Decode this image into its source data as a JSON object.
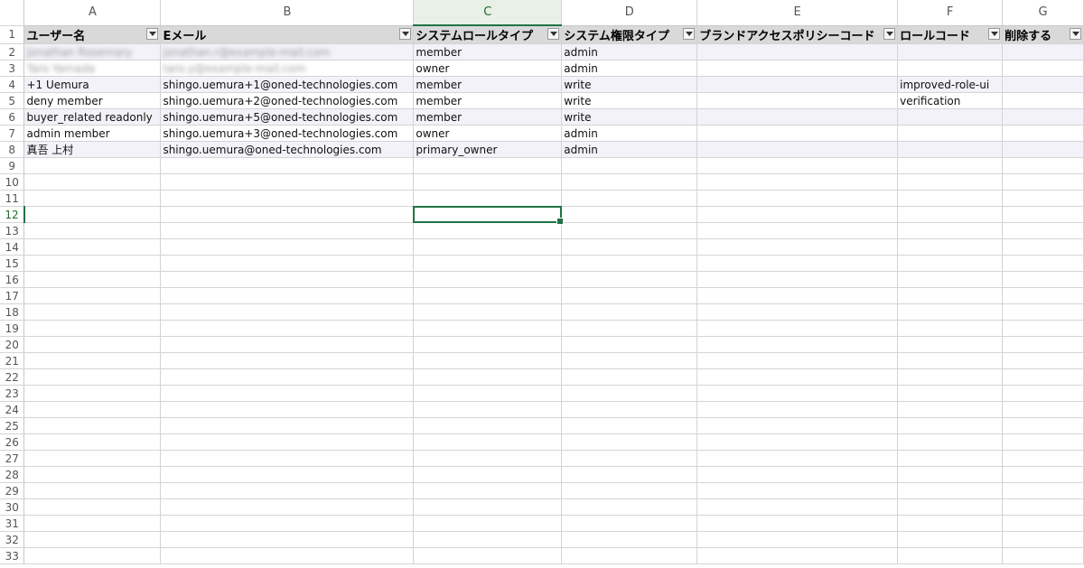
{
  "columns": [
    "A",
    "B",
    "C",
    "D",
    "E",
    "F",
    "G"
  ],
  "header_row_number": "1",
  "headers": [
    "ユーザー名",
    "Eメール",
    "システムロールタイプ",
    "システム権限タイプ",
    "ブランドアクセスポリシーコード",
    "ロールコード",
    "削除する"
  ],
  "rows": [
    {
      "num": "2",
      "cells": [
        "Jonathan Rosemary",
        "jonathan.r@example-mail.com",
        "member",
        "admin",
        "",
        "",
        ""
      ]
    },
    {
      "num": "3",
      "cells": [
        "Taro Yamada",
        "taro.y@example-mail.com",
        "owner",
        "admin",
        "",
        "",
        ""
      ]
    },
    {
      "num": "4",
      "cells": [
        "+1 Uemura",
        "shingo.uemura+1@oned-technologies.com",
        "member",
        "write",
        "",
        "improved-role-ui",
        ""
      ]
    },
    {
      "num": "5",
      "cells": [
        "deny member",
        "shingo.uemura+2@oned-technologies.com",
        "member",
        "write",
        "",
        "verification",
        ""
      ]
    },
    {
      "num": "6",
      "cells": [
        "buyer_related readonly",
        "shingo.uemura+5@oned-technologies.com",
        "member",
        "write",
        "",
        "",
        ""
      ]
    },
    {
      "num": "7",
      "cells": [
        "admin member",
        "shingo.uemura+3@oned-technologies.com",
        "owner",
        "admin",
        "",
        "",
        ""
      ]
    },
    {
      "num": "8",
      "cells": [
        "真吾 上村",
        "shingo.uemura@oned-technologies.com",
        "primary_owner",
        "admin",
        "",
        "",
        ""
      ]
    }
  ],
  "empty_rows": [
    "9",
    "10",
    "11",
    "12",
    "13",
    "14",
    "15",
    "16",
    "17",
    "18",
    "19",
    "20",
    "21",
    "22",
    "23",
    "24",
    "25",
    "26",
    "27",
    "28",
    "29",
    "30",
    "31",
    "32",
    "33"
  ],
  "active_cell": {
    "column": "C",
    "row": "12"
  },
  "blurred_rows": [
    "2",
    "3"
  ],
  "colors": {
    "accent": "#217346",
    "header_fill": "#d9d9d9",
    "band_fill": "#f2f2f8"
  }
}
